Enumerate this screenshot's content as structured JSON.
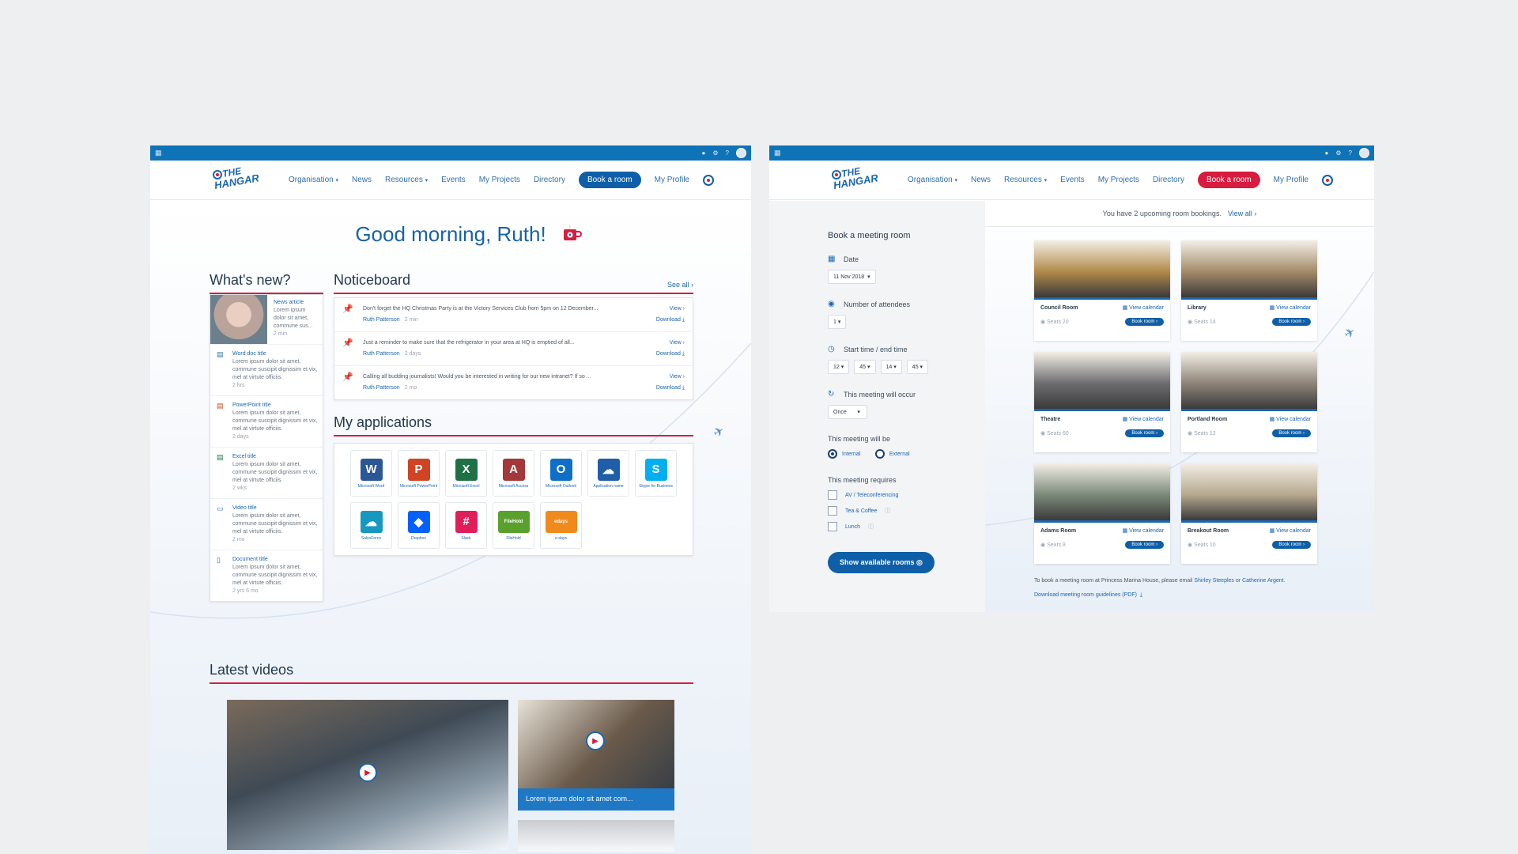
{
  "nav": {
    "items": [
      "Organisation",
      "News",
      "Resources",
      "Events",
      "My Projects",
      "Directory"
    ],
    "book": "Book a room",
    "profile": "My Profile",
    "logo": "THE HANGAR"
  },
  "home": {
    "greeting": "Good morning, Ruth!",
    "whats_new": {
      "title": "What's new?",
      "items": [
        {
          "title": "News article",
          "text": "Lorem ipsum dolor sit amet, commune sus...",
          "age": "2 min",
          "icon": "news-photo"
        },
        {
          "title": "Word doc title",
          "text": "Lorem ipsum dolor sit amet, commune suscipit dignissim et vix, mel at virtute officiis.",
          "age": "2 hrs",
          "icon": "word-icon"
        },
        {
          "title": "PowerPoint title",
          "text": "Lorem ipsum dolor sit amet, commune suscipit dignissim et vix, mel at virtute officiis.",
          "age": "2 days",
          "icon": "powerpoint-icon"
        },
        {
          "title": "Excel title",
          "text": "Lorem ipsum dolor sit amet, commune suscipit dignissim et vix, mel at virtute officiis.",
          "age": "2 wks",
          "icon": "excel-icon"
        },
        {
          "title": "Video title",
          "text": "Lorem ipsum dolor sit amet, commune suscipit dignissim et vix, mel at virtute officiis.",
          "age": "2 mo",
          "icon": "video-icon"
        },
        {
          "title": "Document title",
          "text": "Lorem ipsum dolor sit amet, commune suscipit dignissim et vix, mel at virtute officiis.",
          "age": "2 yrs 6 mo",
          "icon": "document-icon"
        }
      ]
    },
    "noticeboard": {
      "title": "Noticeboard",
      "see_all": "See all",
      "items": [
        {
          "text": "Don't forget the HQ Christmas Party is at the Victory Services Club from 5pm on 12 December...",
          "author": "Ruth Patterson",
          "age": "2 min",
          "view": "View",
          "download": "Download"
        },
        {
          "text": "Just a reminder to make sure that the refrigerator in your area at HQ is emptied of all...",
          "author": "Ruth Patterson",
          "age": "2 days",
          "view": "View",
          "download": "Download"
        },
        {
          "text": "Calling all budding journalists! Would you be interested in writing for our new intranet? If so ...",
          "author": "Ruth Patterson",
          "age": "2 mo",
          "view": "View",
          "download": "Download"
        }
      ]
    },
    "apps": {
      "title": "My applications",
      "items": [
        {
          "label": "Microsoft Word",
          "glyph": "W",
          "color": "#2b5797"
        },
        {
          "label": "Microsoft PowerPoint",
          "glyph": "P",
          "color": "#d04423"
        },
        {
          "label": "Microsoft Excel",
          "glyph": "X",
          "color": "#1e7145"
        },
        {
          "label": "Microsoft Access",
          "glyph": "A",
          "color": "#a4373a"
        },
        {
          "label": "Microsoft Outlook",
          "glyph": "O",
          "color": "#0f6fc6"
        },
        {
          "label": "Application name",
          "glyph": "☁",
          "color": "#1e5fa8"
        },
        {
          "label": "Skype for Business",
          "glyph": "S",
          "color": "#00aff0"
        },
        {
          "label": "SalesForce",
          "glyph": "☁",
          "color": "#1798c1"
        },
        {
          "label": "Dropbox",
          "glyph": "◆",
          "color": "#0061fe"
        },
        {
          "label": "Slack",
          "glyph": "#",
          "color": "#e01e5a"
        },
        {
          "label": "FileHold",
          "glyph": "FileHold",
          "color": "#5aa02c"
        },
        {
          "label": "e-days",
          "glyph": "edays",
          "color": "#f08a1c"
        }
      ]
    },
    "videos": {
      "title": "Latest videos",
      "caption": "Lorem ipsum dolor sit amet com..."
    }
  },
  "booking": {
    "banner": "You have 2 upcoming room bookings.",
    "view_all": "View all",
    "form": {
      "title": "Book a meeting room",
      "date_label": "Date",
      "date_value": "11 Nov 2018",
      "attendees_label": "Number of attendees",
      "attendees_value": "1",
      "time_label": "Start time / end time",
      "start_h": "12",
      "start_m": "45",
      "end_h": "14",
      "end_m": "45",
      "occur_label": "This meeting will occur",
      "occur_value": "Once",
      "will_be_label": "This meeting will be",
      "internal": "Internal",
      "external": "External",
      "requires_label": "This meeting requires",
      "req_av": "AV / Teleconferencing",
      "req_tea": "Tea & Coffee",
      "req_lunch": "Lunch",
      "submit": "Show available rooms"
    },
    "rooms": [
      {
        "name": "Council Room",
        "seats": "Seats 20",
        "view": "View calendar",
        "book": "Book room",
        "tone": "#b08a4a"
      },
      {
        "name": "Library",
        "seats": "Seats 14",
        "view": "View calendar",
        "book": "Book room",
        "tone": "#a48a68"
      },
      {
        "name": "Theatre",
        "seats": "Seats 60",
        "view": "View calendar",
        "book": "Book room",
        "tone": "#6e6e72"
      },
      {
        "name": "Portland Room",
        "seats": "Seats 12",
        "view": "View calendar",
        "book": "Book room",
        "tone": "#8e8478"
      },
      {
        "name": "Adams Room",
        "seats": "Seats 8",
        "view": "View calendar",
        "book": "Book room",
        "tone": "#7c8a7a"
      },
      {
        "name": "Breakout Room",
        "seats": "Seats 10",
        "view": "View calendar",
        "book": "Book room",
        "tone": "#b6a88e"
      }
    ],
    "footnote_pre": "To book a meeting room at Princess Marina House, please email",
    "footnote_p1": "Shirley Steeples",
    "footnote_or": "or",
    "footnote_p2": "Catherine Argent.",
    "guidelines": "Download meeting room guidelines (PDF)"
  }
}
